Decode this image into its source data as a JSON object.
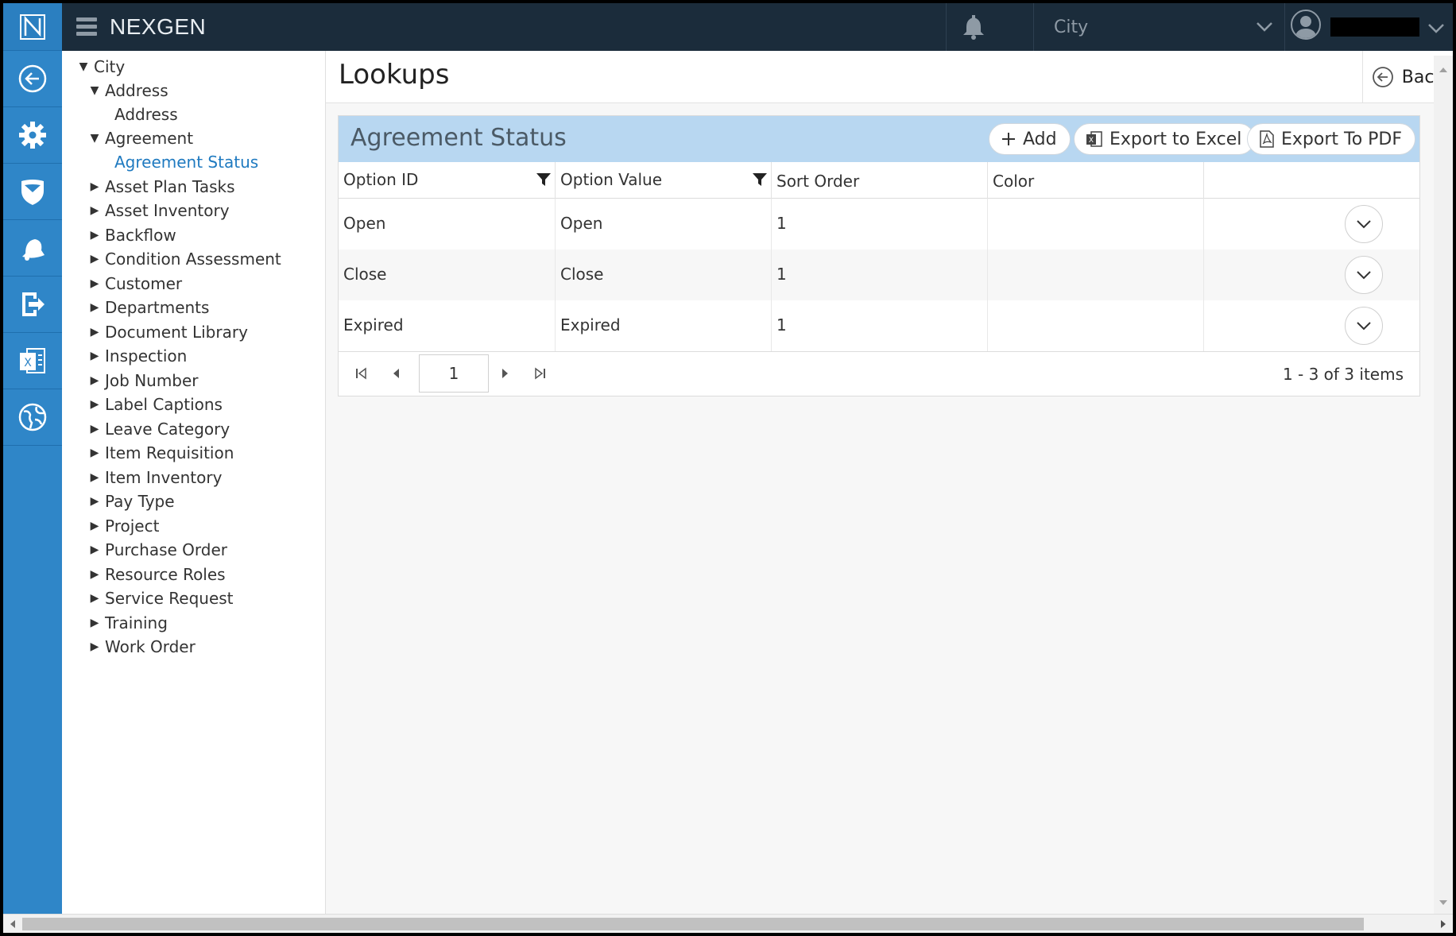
{
  "brand": "NEXGEN",
  "rail": {
    "icons": [
      "logo-icon",
      "back-circle-icon",
      "gear-icon",
      "shield-icon",
      "bell-icon",
      "exit-icon",
      "excel-icon",
      "globe-icon"
    ]
  },
  "topbar": {
    "city_select": {
      "value": "City"
    }
  },
  "tree": {
    "root": "City",
    "address_group": "Address",
    "address_item": "Address",
    "agreement_group": "Agreement",
    "agreement_status": "Agreement Status",
    "items": [
      "Asset Plan Tasks",
      "Asset Inventory",
      "Backflow",
      "Condition Assessment",
      "Customer",
      "Departments",
      "Document Library",
      "Inspection",
      "Job Number",
      "Label Captions",
      "Leave Category",
      "Item Requisition",
      "Item Inventory",
      "Pay Type",
      "Project",
      "Purchase Order",
      "Resource Roles",
      "Service Request",
      "Training",
      "Work Order"
    ]
  },
  "page": {
    "title": "Lookups",
    "back_label": "Back"
  },
  "grid": {
    "title": "Agreement Status",
    "add_label": "Add",
    "excel_label": "Export to Excel",
    "pdf_label": "Export To PDF",
    "columns": [
      "Option ID",
      "Option Value",
      "Sort Order",
      "Color"
    ],
    "rows": [
      {
        "option_id": "Open",
        "option_value": "Open",
        "sort_order": "1",
        "color": ""
      },
      {
        "option_id": "Close",
        "option_value": "Close",
        "sort_order": "1",
        "color": ""
      },
      {
        "option_id": "Expired",
        "option_value": "Expired",
        "sort_order": "1",
        "color": ""
      }
    ],
    "pager": {
      "page": "1",
      "info": "1 - 3 of 3 items"
    }
  },
  "colors": {
    "rail": "#2f86c8",
    "topbar": "#1b2c3b",
    "grid_header": "#b8d7f1",
    "link": "#1f7ac0"
  }
}
